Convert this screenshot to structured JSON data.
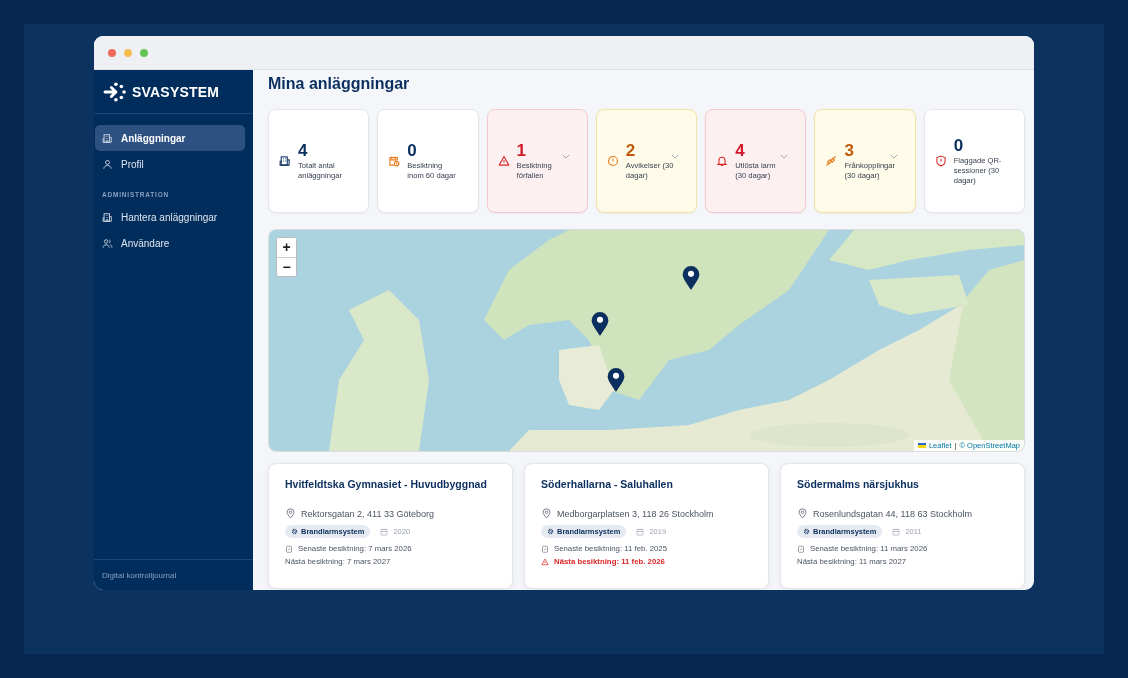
{
  "sidebar": {
    "brand": "SVASYSTEM",
    "items": [
      {
        "label": "Anläggningar",
        "selected": true
      },
      {
        "label": "Profil",
        "selected": false
      }
    ],
    "section_label": "ADMINISTRATION",
    "admin_items": [
      {
        "label": "Hantera anläggningar",
        "selected": false
      },
      {
        "label": "Användare",
        "selected": false
      }
    ],
    "footer": "Digital kontrolljournal"
  },
  "page_title": "Mina anläggningar",
  "stats": [
    {
      "value": "4",
      "label": "Totalt antal anläggningar",
      "kind": "neutral",
      "expandable": false
    },
    {
      "value": "0",
      "label": "Besiktning inom 60 dagar",
      "kind": "neutral",
      "expandable": false
    },
    {
      "value": "1",
      "label": "Besiktning förfallen",
      "kind": "danger",
      "expandable": true
    },
    {
      "value": "2",
      "label": "Avvikelser (30 dagar)",
      "kind": "warning",
      "expandable": true
    },
    {
      "value": "4",
      "label": "Utlösta larm (30 dagar)",
      "kind": "danger",
      "expandable": true
    },
    {
      "value": "3",
      "label": "Frånkopplingar (30 dagar)",
      "kind": "warning",
      "expandable": true
    },
    {
      "value": "0",
      "label": "Flaggade QR-sessioner (30 dagar)",
      "kind": "neutral",
      "expandable": false
    }
  ],
  "map": {
    "zoom_in": "+",
    "zoom_out": "−",
    "attribution_link": "Leaflet",
    "attribution_sep": "|",
    "attribution_text": "© OpenStreetMap"
  },
  "facilities": [
    {
      "name": "Hvitfeldtska Gymnasiet - Huvudbyggnad",
      "address": "Rektorsgatan 2, 411 33 Göteborg",
      "tag": "Brandlarmsystem",
      "year": "2020",
      "last_inspection": "Senaste besiktning: 7 mars 2026",
      "next_inspection": "Nästa besiktning: 7 mars 2027",
      "overdue": false
    },
    {
      "name": "Söderhallarna - Saluhallen",
      "address": "Medborgarplatsen 3, 118 26 Stockholm",
      "tag": "Brandlarmsystem",
      "year": "2019",
      "last_inspection": "Senaste besiktning: 11 feb. 2025",
      "next_inspection": "Nästa besiktning: 11 feb. 2026",
      "overdue": true
    },
    {
      "name": "Södermalms närsjukhus",
      "address": "Rosenlundsgatan 44, 118 63 Stockholm",
      "tag": "Brandlarmsystem",
      "year": "2011",
      "last_inspection": "Senaste besiktning: 11 mars 2026",
      "next_inspection": "Nästa besiktning: 11 mars 2027",
      "overdue": false
    }
  ]
}
